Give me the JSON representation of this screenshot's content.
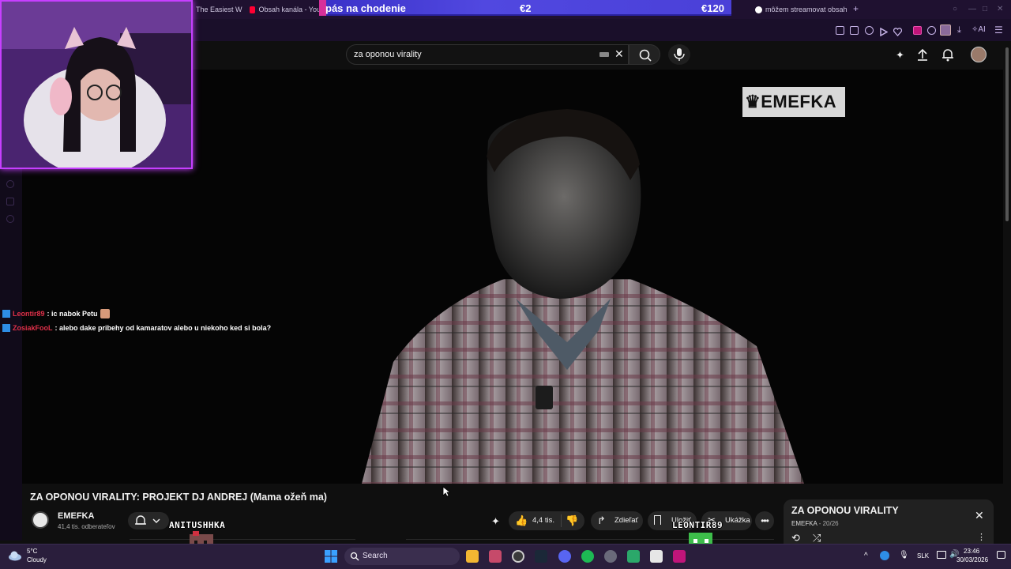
{
  "browser": {
    "tabs": [
      {
        "label": "The Easiest W"
      },
      {
        "label": "Obsah kanála - You"
      },
      {
        "label": "môžem streamovat obsah"
      }
    ],
    "new_tab_symbol": "+"
  },
  "donation_goal": {
    "label": "pás na chodenie",
    "current": "€2",
    "target": "€120",
    "progress_fraction": 0.017,
    "colors": {
      "bar": "#4a40d8",
      "fill": "#d6309a"
    }
  },
  "toolbar": {
    "ai_label": "AI"
  },
  "youtube": {
    "search_query": "za oponou virality",
    "video": {
      "watermark": "EMEFKA",
      "title": "ZA OPONOU VIRALITY: PROJEKT DJ ANDREJ (Mama ožeň ma)"
    },
    "channel": {
      "name": "EMEFKA",
      "subscribers": "41,4 tis. odberateľov"
    },
    "actions": {
      "likes": "4,4 tis.",
      "share": "Zdieľať",
      "save": "Uložiť",
      "clip": "Ukážka"
    },
    "playlist": {
      "title": "ZA OPONOU VIRALITY",
      "channel": "EMEFKA",
      "position": "20/26"
    }
  },
  "chat": [
    {
      "user": "Leontir89",
      "message": ": ic nabok Petu"
    },
    {
      "user": "ZosiakFooL",
      "message": ": alebo dake pribehy od kamaratov alebo u niekoho ked si bola?"
    }
  ],
  "sprites": [
    {
      "name": "ANITUSHHKA"
    },
    {
      "name": "LEONTIR89"
    }
  ],
  "taskbar": {
    "weather_temp": "5°C",
    "weather_desc": "Cloudy",
    "search_label": "Search",
    "language": "SLK",
    "time": "23:46",
    "date": "30/03/2026"
  }
}
